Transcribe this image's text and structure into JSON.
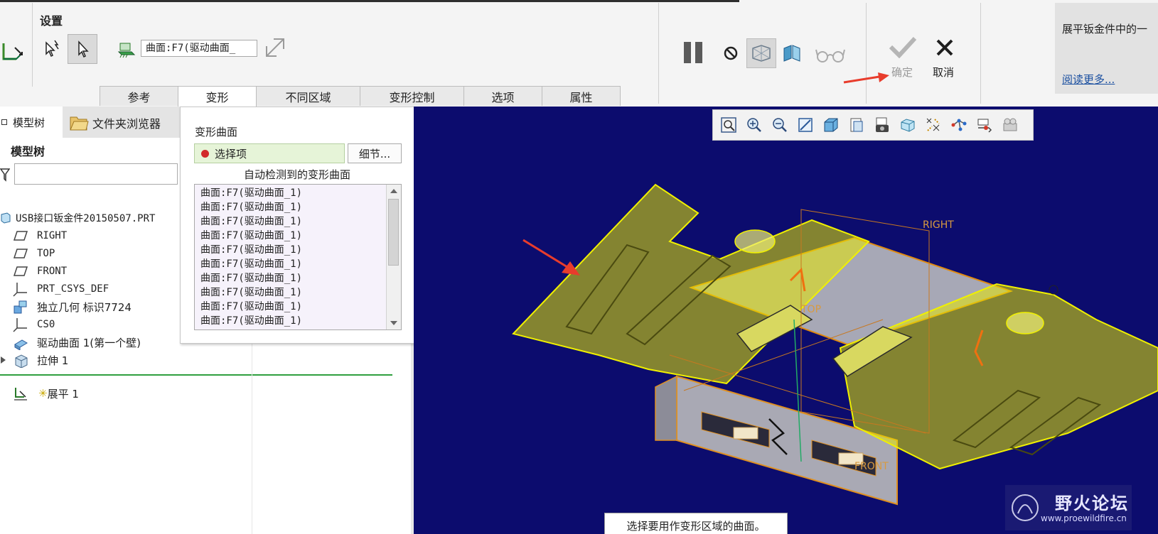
{
  "ribbon": {
    "settings_label": "设置",
    "surface_field_value": "曲面:F7(驱动曲面_",
    "tabs": [
      "参考",
      "变形",
      "不同区域",
      "变形控制",
      "选项",
      "属性"
    ],
    "ok_label": "确定",
    "cancel_label": "取消",
    "help_text": "展平钣金件中的一",
    "read_more": "阅读更多..."
  },
  "left_panel": {
    "tab_model_tree": "模型树",
    "tab_folder_browser": "文件夹浏览器",
    "heading": "模型树",
    "filter_value": "",
    "items": [
      {
        "label": "USB接口钣金件20150507.PRT",
        "icon": "part-icon"
      },
      {
        "label": "RIGHT",
        "icon": "plane-icon"
      },
      {
        "label": "TOP",
        "icon": "plane-icon"
      },
      {
        "label": "FRONT",
        "icon": "plane-icon"
      },
      {
        "label": "PRT_CSYS_DEF",
        "icon": "csys-icon"
      },
      {
        "label": "独立几何 标识7724",
        "icon": "geometry-icon"
      },
      {
        "label": "CS0",
        "icon": "csys-icon"
      },
      {
        "label": "驱动曲面 1(第一个壁)",
        "icon": "sheetmetal-wall-icon"
      },
      {
        "label": "拉伸 1",
        "icon": "extrude-icon"
      }
    ],
    "flatten_item": "展平 1"
  },
  "deform_panel": {
    "section_label": "变形曲面",
    "select_item": "选择项",
    "details_button": "细节...",
    "auto_detected_label": "自动检测到的变形曲面",
    "surfaces": [
      "曲面:F7(驱动曲面_1)",
      "曲面:F7(驱动曲面_1)",
      "曲面:F7(驱动曲面_1)",
      "曲面:F7(驱动曲面_1)",
      "曲面:F7(驱动曲面_1)",
      "曲面:F7(驱动曲面_1)",
      "曲面:F7(驱动曲面_1)",
      "曲面:F7(驱动曲面_1)",
      "曲面:F7(驱动曲面_1)",
      "曲面:F7(驱动曲面_1)"
    ]
  },
  "viewport": {
    "datum_right": "RIGHT",
    "datum_top": "TOP",
    "datum_front": "FRONT",
    "status_message": "选择要用作变形区域的曲面。",
    "watermark_title": "野火论坛",
    "watermark_url": "www.proewildfire.cn",
    "background_color": "#0c0c6e",
    "highlight_color": "#e8e800"
  }
}
